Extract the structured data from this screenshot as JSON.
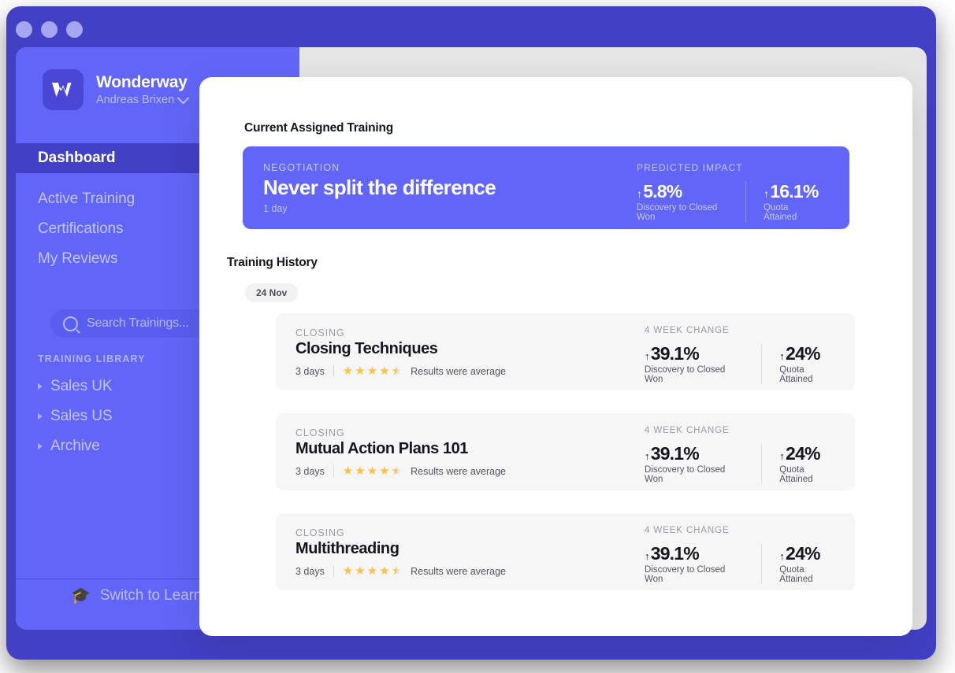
{
  "window": {
    "dots": [
      "close-dot",
      "minimize-dot",
      "maximize-dot"
    ]
  },
  "sidebar": {
    "brand": {
      "name": "Wonderway",
      "user": "Andreas Brixen",
      "logo_letter": "W"
    },
    "nav": [
      {
        "label": "Dashboard",
        "active": true
      },
      {
        "label": "Active Training",
        "active": false
      },
      {
        "label": "Certifications",
        "active": false
      },
      {
        "label": "My Reviews",
        "active": false
      }
    ],
    "search": {
      "placeholder": "Search Trainings..."
    },
    "library": {
      "title": "TRAINING LIBRARY",
      "items": [
        {
          "label": "Sales UK"
        },
        {
          "label": "Sales US"
        },
        {
          "label": "Archive"
        }
      ]
    },
    "switch_mode": {
      "label": "Switch to Learner",
      "icon": "graduation-cap-icon"
    }
  },
  "panel": {
    "current_section_title": "Current Assigned Training",
    "featured": {
      "kicker": "NEGOTIATION",
      "title": "Never split the difference",
      "duration": "1 day",
      "metrics_kicker": "PREDICTED IMPACT",
      "metrics": [
        {
          "arrow": "↑",
          "value": "5.8%",
          "label": "Discovery to Closed Won"
        },
        {
          "arrow": "↑",
          "value": "16.1%",
          "label": "Quota Attained"
        }
      ]
    },
    "history_section_title": "Training History",
    "date_pill": "24 Nov",
    "history": [
      {
        "kicker": "CLOSING",
        "title": "Closing Techniques",
        "duration": "3 days",
        "rating": 4.5,
        "rating_text": "Results were average",
        "metrics_kicker": "4 WEEK CHANGE",
        "metrics": [
          {
            "arrow": "↑",
            "value": "39.1%",
            "label": "Discovery to Closed Won"
          },
          {
            "arrow": "↑",
            "value": "24%",
            "label": "Quota Attained"
          }
        ]
      },
      {
        "kicker": "CLOSING",
        "title": "Mutual Action Plans 101",
        "duration": "3 days",
        "rating": 4.5,
        "rating_text": "Results were average",
        "metrics_kicker": "4 WEEK CHANGE",
        "metrics": [
          {
            "arrow": "↑",
            "value": "39.1%",
            "label": "Discovery to Closed Won"
          },
          {
            "arrow": "↑",
            "value": "24%",
            "label": "Quota Attained"
          }
        ]
      },
      {
        "kicker": "CLOSING",
        "title": "Multithreading",
        "duration": "3 days",
        "rating": 4.5,
        "rating_text": "Results were average",
        "metrics_kicker": "4 WEEK CHANGE",
        "metrics": [
          {
            "arrow": "↑",
            "value": "39.1%",
            "label": "Discovery to Closed Won"
          },
          {
            "arrow": "↑",
            "value": "24%",
            "label": "Quota Attained"
          }
        ]
      }
    ]
  },
  "colors": {
    "window_frame": "#4240c4",
    "sidebar": "#6166f8",
    "sidebar_active": "#4240c4",
    "content_plate": "#e5e5e5",
    "accent": "#6166f8",
    "star": "#fcc13f",
    "row_bg": "#f6f6f7"
  }
}
